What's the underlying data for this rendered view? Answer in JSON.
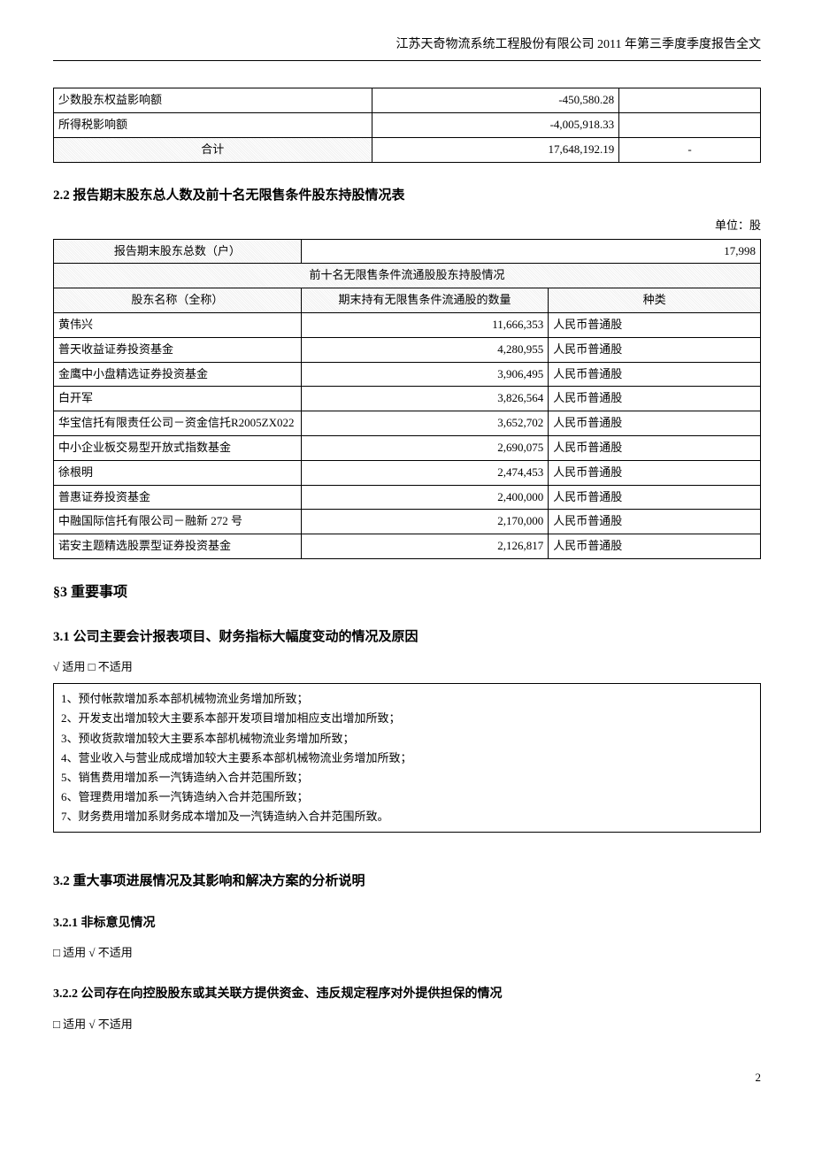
{
  "header": "江苏天奇物流系统工程股份有限公司 2011 年第三季度季度报告全文",
  "table1": {
    "rows": [
      {
        "label": "少数股东权益影响额",
        "value": "-450,580.28",
        "extra": ""
      },
      {
        "label": "所得税影响额",
        "value": "-4,005,918.33",
        "extra": ""
      }
    ],
    "total_label": "合计",
    "total_value": "17,648,192.19",
    "total_extra": "-"
  },
  "sec22": {
    "title": "2.2 报告期末股东总人数及前十名无限售条件股东持股情况表",
    "unit": "单位：股",
    "total_shareholders_label": "报告期末股东总数（户）",
    "total_shareholders_value": "17,998",
    "subheader": "前十名无限售条件流通股股东持股情况",
    "cols": [
      "股东名称（全称）",
      "期末持有无限售条件流通股的数量",
      "种类"
    ],
    "rows": [
      {
        "name": "黄伟兴",
        "qty": "11,666,353",
        "type": "人民币普通股"
      },
      {
        "name": "普天收益证券投资基金",
        "qty": "4,280,955",
        "type": "人民币普通股"
      },
      {
        "name": "金鹰中小盘精选证券投资基金",
        "qty": "3,906,495",
        "type": "人民币普通股"
      },
      {
        "name": "白开军",
        "qty": "3,826,564",
        "type": "人民币普通股"
      },
      {
        "name": "华宝信托有限责任公司－资金信托R2005ZX022",
        "qty": "3,652,702",
        "type": "人民币普通股"
      },
      {
        "name": "中小企业板交易型开放式指数基金",
        "qty": "2,690,075",
        "type": "人民币普通股"
      },
      {
        "name": "徐根明",
        "qty": "2,474,453",
        "type": "人民币普通股"
      },
      {
        "name": "普惠证券投资基金",
        "qty": "2,400,000",
        "type": "人民币普通股"
      },
      {
        "name": "中融国际信托有限公司－融新 272 号",
        "qty": "2,170,000",
        "type": "人民币普通股"
      },
      {
        "name": "诺安主题精选股票型证券投资基金",
        "qty": "2,126,817",
        "type": "人民币普通股"
      }
    ]
  },
  "sec3": {
    "title": "§3  重要事项"
  },
  "sec31": {
    "title": "3.1 公司主要会计报表项目、财务指标大幅度变动的情况及原因",
    "applicable": "√ 适用 □ 不适用",
    "items": [
      "1、预付帐款增加系本部机械物流业务增加所致；",
      "2、开发支出增加较大主要系本部开发项目增加相应支出增加所致；",
      "3、预收货款增加较大主要系本部机械物流业务增加所致；",
      "4、营业收入与营业成成增加较大主要系本部机械物流业务增加所致；",
      "5、销售费用增加系一汽铸造纳入合并范围所致；",
      "6、管理费用增加系一汽铸造纳入合并范围所致；",
      "7、财务费用增加系财务成本增加及一汽铸造纳入合并范围所致。"
    ]
  },
  "sec32": {
    "title": "3.2 重大事项进展情况及其影响和解决方案的分析说明"
  },
  "sec321": {
    "title": "3.2.1 非标意见情况",
    "applicable": "□ 适用 √ 不适用"
  },
  "sec322": {
    "title": "3.2.2 公司存在向控股股东或其关联方提供资金、违反规定程序对外提供担保的情况",
    "applicable": "□ 适用 √ 不适用"
  },
  "page_number": "2"
}
